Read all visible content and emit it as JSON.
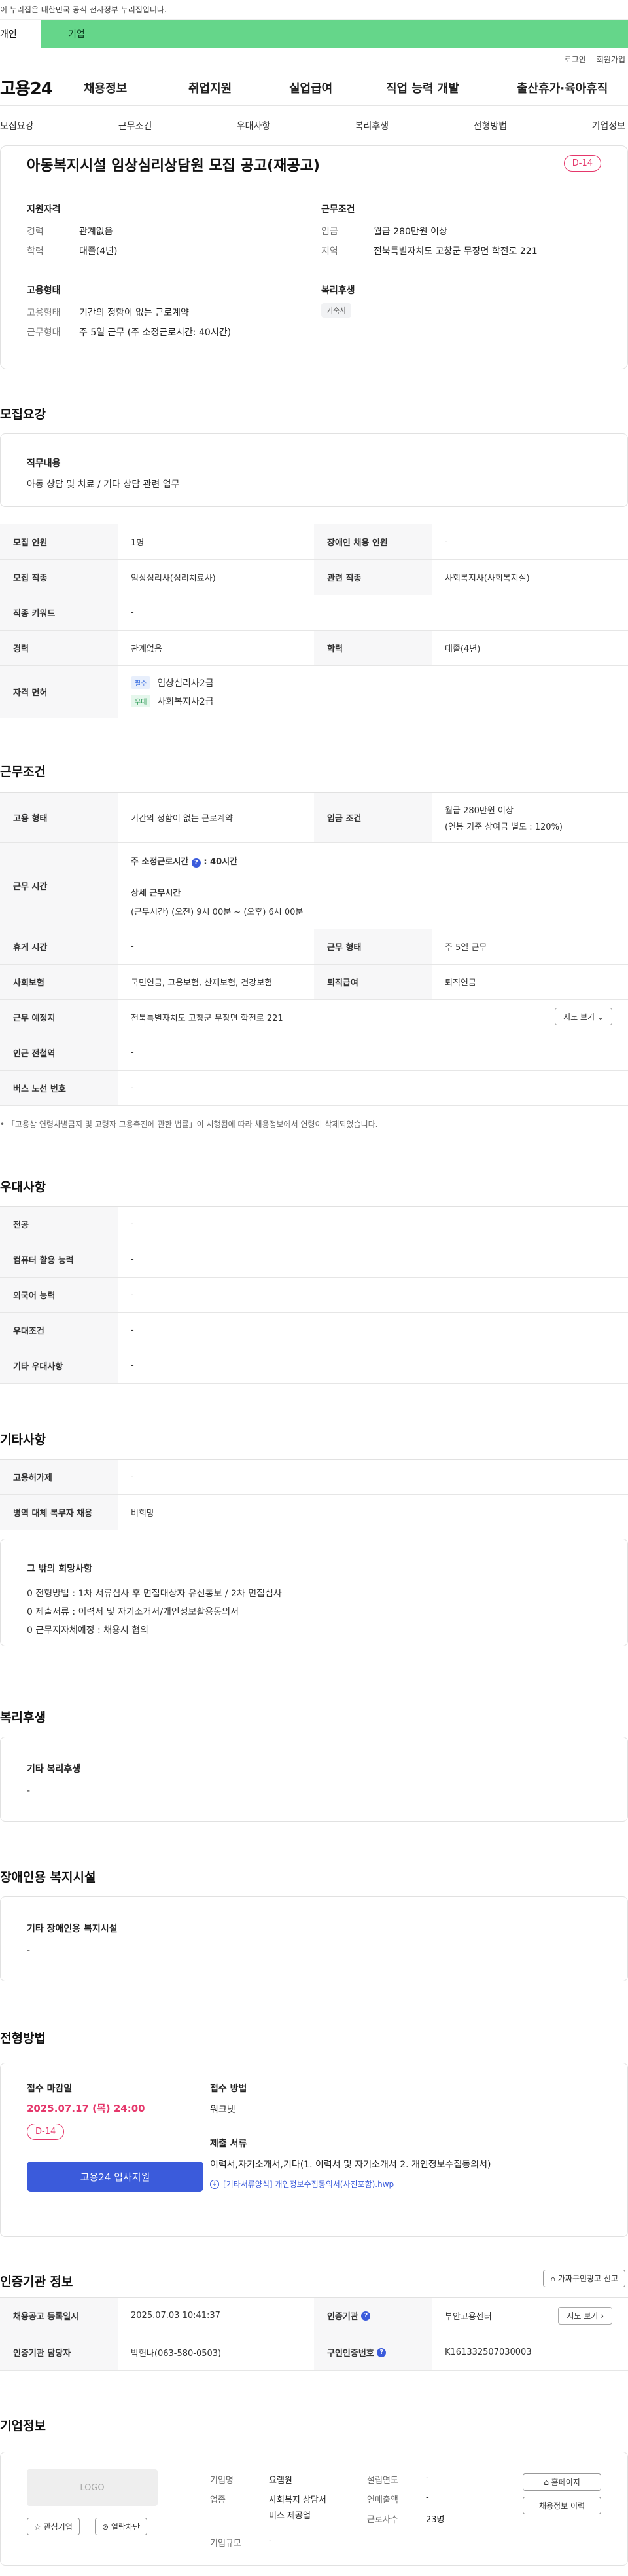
{
  "banner": {
    "text": "이 누리집은 대한민국 공식 전자정부 누리집입니다."
  },
  "tabs": {
    "personal": "개인",
    "business": "기업"
  },
  "util": {
    "login": "로그인",
    "signup": "회원가입"
  },
  "logo": "고용24",
  "mainnav": [
    "채용정보",
    "취업지원",
    "실업급여",
    "직업 능력 개발",
    "출산휴가·육아휴직"
  ],
  "subnav": [
    "모집요강",
    "근무조건",
    "우대사항",
    "복리후생",
    "전형방법",
    "기업정보"
  ],
  "summary": {
    "title": "아동복지시설 임상심리상담원 모집 공고(재공고)",
    "dday": "D-14",
    "qual_title": "지원자격",
    "qual": [
      {
        "k": "경력",
        "v": "관계없음"
      },
      {
        "k": "학력",
        "v": "대졸(4년)"
      }
    ],
    "cond_title": "근무조건",
    "cond": [
      {
        "k": "임금",
        "v": "월급 280만원 이상"
      },
      {
        "k": "지역",
        "v": "전북특별자치도 고창군 무장면 학전로 221"
      }
    ],
    "emp_title": "고용형태",
    "emp": [
      {
        "k": "고용형태",
        "v": "기간의 정함이 없는 근로계약"
      },
      {
        "k": "근무형태",
        "v": "주 5일 근무 (주 소정근로시간: 40시간)"
      }
    ],
    "welfare_title": "복리후생",
    "welfare_tag": "기숙사"
  },
  "recruit": {
    "heading": "모집요강",
    "duty_title": "직무내용",
    "duty": "아동 상담 및 치료 / 기타 상담 관련 업무",
    "rows": {
      "headcount_k": "모집 인원",
      "headcount_v": "1명",
      "disabled_k": "장애인 채용 인원",
      "disabled_v": "-",
      "job_k": "모집 직종",
      "job_v": "임상심리사(심리치료사)",
      "related_k": "관련 직종",
      "related_v": "사회복지사(사회복지실)",
      "keyword_k": "직종 키워드",
      "keyword_v": "-",
      "career_k": "경력",
      "career_v": "관계없음",
      "edu_k": "학력",
      "edu_v": "대졸(4년)",
      "license_k": "자격 면허",
      "license": [
        {
          "badge": "필수",
          "name": "임상심리사2급"
        },
        {
          "badge": "우대",
          "name": "사회복지사2급"
        }
      ]
    }
  },
  "work": {
    "heading": "근무조건",
    "type_k": "고용 형태",
    "type_v": "기간의 정함이 없는 근로계약",
    "wage_k": "임금 조건",
    "wage_v1": "월급 280만원 이상",
    "wage_v2": "(연봉 기준 상여금 별도 : 120%)",
    "hours_k": "근무 시간",
    "hours_weekly_label": "주 소정근로시간",
    "hours_weekly": ": 40시간",
    "hours_detail_label": "상세 근무시간",
    "hours_detail": "(근무시간) (오전) 9시 00분 ~ (오후) 6시 00분",
    "rest_k": "휴게 시간",
    "rest_v": "-",
    "shift_k": "근무 형태",
    "shift_v": "주 5일 근무",
    "insure_k": "사회보험",
    "insure_v": "국민연금, 고용보험, 산재보험, 건강보험",
    "retire_k": "퇴직급여",
    "retire_v": "퇴직연금",
    "place_k": "근무 예정지",
    "place_v": "전북특별자치도 고창군 무장면 학전로 221",
    "map_btn": "지도 보기",
    "subway_k": "인근 전철역",
    "subway_v": "-",
    "bus_k": "버스 노선 번호",
    "bus_v": "-",
    "note": "「고용상 연령차별금지 및 고령자 고용촉진에 관한 법률」이 시행됨에 따라 채용정보에서 연령이 삭제되었습니다."
  },
  "pref": {
    "heading": "우대사항",
    "rows": [
      {
        "k": "전공",
        "v": "-"
      },
      {
        "k": "컴퓨터 활용 능력",
        "v": "-"
      },
      {
        "k": "외국어 능력",
        "v": "-"
      },
      {
        "k": "우대조건",
        "v": "-"
      },
      {
        "k": "기타 우대사항",
        "v": "-"
      }
    ]
  },
  "etc": {
    "heading": "기타사항",
    "rows": [
      {
        "k": "고용허가제",
        "v": "-"
      },
      {
        "k": "병역 대체 복무자 채용",
        "v": "비희망"
      }
    ],
    "other_title": "그 밖의 희망사항",
    "other": [
      "0 전형방법 : 1차 서류심사 후 면접대상자 유선통보 / 2차 면접심사",
      "0 제출서류 : 이력서 및 자기소개서/개인정보활용동의서",
      "0 근무지자체예정 : 채용시 협의"
    ]
  },
  "welfare": {
    "heading": "복리후생",
    "title": "기타 복리후생",
    "value": "-"
  },
  "disab": {
    "heading": "장애인용 복지시설",
    "title": "기타 장애인용 복지시설",
    "value": "-"
  },
  "apply": {
    "heading": "전형방법",
    "deadline_label": "접수 마감일",
    "deadline": "2025.07.17 (목) 24:00",
    "dday": "D-14",
    "btn": "고용24 입사지원",
    "method_label": "접수 방법",
    "method": "워크넷",
    "docs_label": "제출 서류",
    "docs": "이력서,자기소개서,기타(1. 이력서 및 자기소개서 2. 개인정보수집동의서)",
    "file": "[기타서류양식] 개인정보수집동의서(사진포함).hwp"
  },
  "cert": {
    "heading": "인증기관 정보",
    "report_btn": "가짜구인광고 신고",
    "reg_k": "채용공고 등록일시",
    "reg_v": "2025.07.03 10:41:37",
    "org_k": "인증기관",
    "org_v": "부안고용센터",
    "map_btn": "지도 보기",
    "mgr_k": "인증기관 담당자",
    "mgr_v": "박현나(063-580-0503)",
    "num_k": "구인인증번호",
    "num_v": "K161332507030003"
  },
  "corp": {
    "heading": "기업정보",
    "logo_ph": "LOGO",
    "interest_btn": "관심기업",
    "block_btn": "열람차단",
    "name_k": "기업명",
    "name_v": "요렘원",
    "industry_k": "업종",
    "industry_v1": "사회복지 상담서",
    "industry_v2": "비스 제공업",
    "size_k": "기업규모",
    "size_v": "-",
    "founded_k": "설립연도",
    "founded_v": "-",
    "sales_k": "연매출액",
    "sales_v": "-",
    "staff_k": "근로자수",
    "staff_v": "23명",
    "home_btn": "홈페이지",
    "history_btn": "채용정보 이력"
  }
}
